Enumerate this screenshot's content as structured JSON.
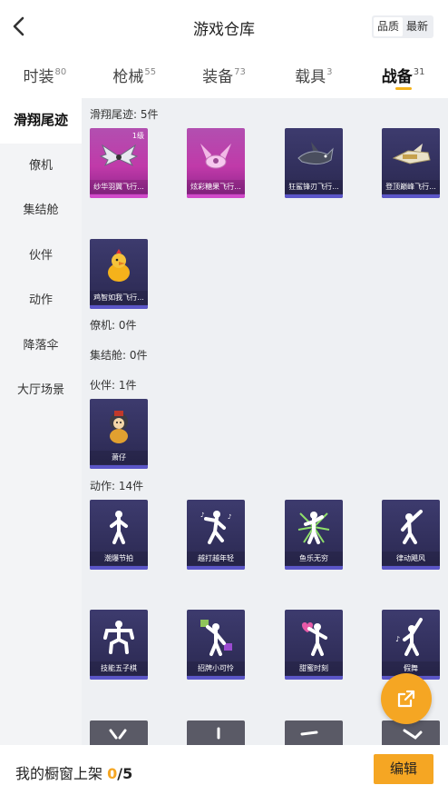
{
  "header": {
    "title": "游戏仓库",
    "sort_options": [
      "品质",
      "最新"
    ]
  },
  "tabs": [
    {
      "label": "时装",
      "count": "80"
    },
    {
      "label": "枪械",
      "count": "55"
    },
    {
      "label": "装备",
      "count": "73"
    },
    {
      "label": "载具",
      "count": "3"
    },
    {
      "label": "战备",
      "count": "31"
    }
  ],
  "sidebar": {
    "items": [
      "滑翔尾迹",
      "僚机",
      "集结舱",
      "伙伴",
      "动作",
      "降落伞",
      "大厅场景"
    ]
  },
  "sections": {
    "glide": {
      "title": "滑翔尾迹: 5件"
    },
    "wingman": {
      "title": "僚机: 0件"
    },
    "pod": {
      "title": "集结舱: 0件"
    },
    "partner": {
      "title": "伙伴: 1件"
    },
    "emote": {
      "title": "动作: 14件"
    }
  },
  "items": {
    "glide": [
      "纱华羽翼飞行...",
      "炫彩糖果飞行...",
      "狂鲨锋刃飞行...",
      "登顶巅峰飞行...",
      "鸡智如我飞行..."
    ],
    "glide_level": "1级",
    "partner": [
      "萧仔"
    ],
    "emote": [
      "潮爆节拍",
      "越打越年轻",
      "鱼乐无穷",
      "律动飓风",
      "技能五子棋",
      "招牌小可怜",
      "甜蜜时刻",
      "假舞"
    ]
  },
  "bottom": {
    "shelf_label": "我的橱窗上架",
    "shelf_current": "0",
    "shelf_total": "/5",
    "edit_label": "编辑"
  },
  "colors": {
    "accent": "#f5a623",
    "tab_indicator": "#f5b21b",
    "card_dark": "#2a2850",
    "card_pink": "#c03aa9"
  }
}
